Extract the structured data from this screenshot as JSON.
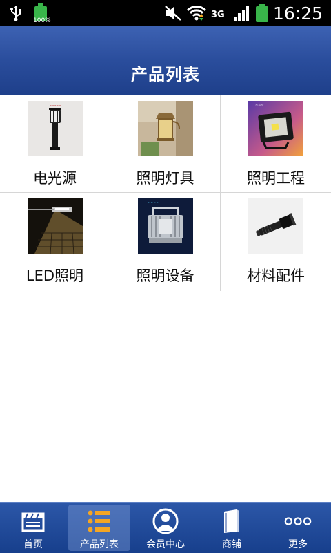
{
  "status_bar": {
    "battery_small_pct": "100%",
    "network": "3G",
    "time": "16:25"
  },
  "header": {
    "title": "产品列表"
  },
  "categories": [
    {
      "label": "电光源",
      "icon": "lamp-post-image"
    },
    {
      "label": "照明灯具",
      "icon": "wall-lantern-image"
    },
    {
      "label": "照明工程",
      "icon": "floodlight-image"
    },
    {
      "label": "LED照明",
      "icon": "street-light-image"
    },
    {
      "label": "照明设备",
      "icon": "led-flood-fixture-image"
    },
    {
      "label": "材料配件",
      "icon": "flashlight-image"
    }
  ],
  "bottom_nav": [
    {
      "label": "首页",
      "icon": "home-film-icon"
    },
    {
      "label": "产品列表",
      "icon": "list-icon",
      "active": true
    },
    {
      "label": "会员中心",
      "icon": "user-icon"
    },
    {
      "label": "商铺",
      "icon": "shop-book-icon"
    },
    {
      "label": "更多",
      "icon": "more-dots-icon"
    }
  ],
  "colors": {
    "header_top": "#3d62b3",
    "header_bottom": "#1e3f8a",
    "nav_bg": "#214a98",
    "battery": "#39b54a"
  }
}
